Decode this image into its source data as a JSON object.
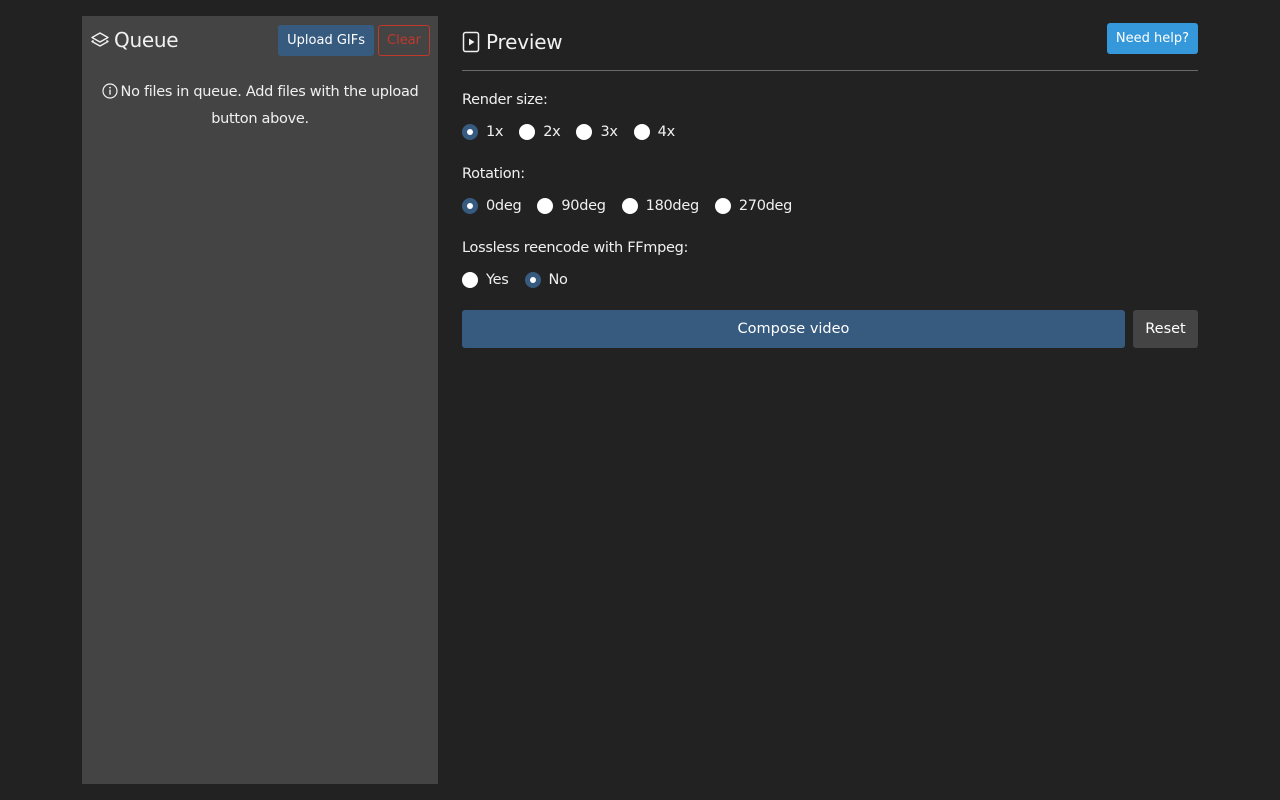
{
  "queue": {
    "title": "Queue",
    "icon": "layers-icon",
    "upload_label": "Upload GIFs",
    "clear_label": "Clear",
    "empty_message": "No files in queue. Add files with the upload button above."
  },
  "preview": {
    "title": "Preview",
    "icon": "play-file-icon",
    "help_label": "Need help?"
  },
  "settings": {
    "render_size": {
      "label": "Render size:",
      "options": [
        "1x",
        "2x",
        "3x",
        "4x"
      ],
      "selected": "1x"
    },
    "rotation": {
      "label": "Rotation:",
      "options": [
        "0deg",
        "90deg",
        "180deg",
        "270deg"
      ],
      "selected": "0deg"
    },
    "lossless": {
      "label": "Lossless reencode with FFmpeg:",
      "options": [
        "Yes",
        "No"
      ],
      "selected": "No"
    }
  },
  "actions": {
    "compose_label": "Compose video",
    "reset_label": "Reset"
  },
  "colors": {
    "background": "#222222",
    "panel": "#444444",
    "primary": "#375a7f",
    "info": "#3498db",
    "danger": "#c0392b"
  }
}
